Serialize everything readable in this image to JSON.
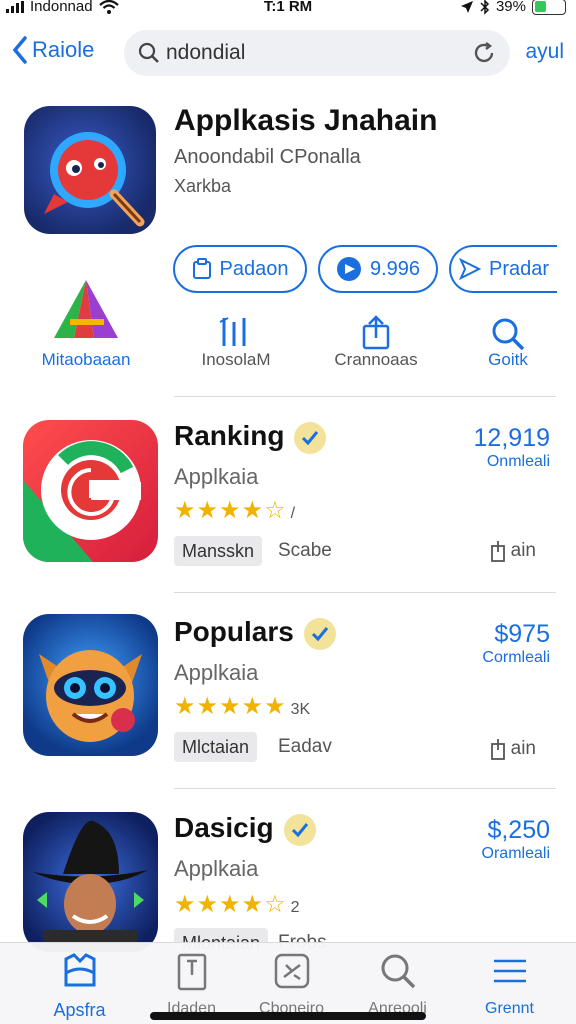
{
  "status_bar": {
    "carrier": "Indonnad",
    "time": "T:1 RM",
    "battery": "39%",
    "battery_level": 0.39
  },
  "nav": {
    "back_label": "Raiole",
    "search_value": "ndondial",
    "right_label": "ayul"
  },
  "hero": {
    "title": "Applkasis Jnahain",
    "subtitle": "Anoondabil CPonalla",
    "subtitle2": "Xarkba",
    "pills": [
      {
        "label": "Padaon",
        "icon": "clipboard-icon"
      },
      {
        "label": "9.996",
        "icon": "play-icon"
      },
      {
        "label": "Pradar",
        "icon": "send-icon"
      }
    ],
    "actions": [
      {
        "label": "Mitaobaaan",
        "icon": "logo-a-icon"
      },
      {
        "label": "InosolaM",
        "icon": "chart-icon"
      },
      {
        "label": "Crannoaas",
        "icon": "share-icon"
      },
      {
        "label": "Goitk",
        "icon": "search-icon"
      }
    ]
  },
  "apps": [
    {
      "title": "Ranking",
      "subtitle": "Applkaia",
      "rating": 4.5,
      "stars": "★★★★☆",
      "rating_count": "/",
      "tag": "Mansskn",
      "tag2": "Scabe",
      "price": "12,919",
      "price_caption": "Onmleali",
      "get_label": "ain"
    },
    {
      "title": "Populars",
      "subtitle": "Applkaia",
      "rating": 5,
      "stars": "★★★★★",
      "rating_count": "3K",
      "tag": "Mlctaian",
      "tag2": "Eadav",
      "price": "$975",
      "price_caption": "Cormleali",
      "get_label": "ain"
    },
    {
      "title": "Dasicig",
      "subtitle": "Applkaia",
      "rating": 4.5,
      "stars": "★★★★☆",
      "rating_count": "2",
      "tag": "Mlontaian",
      "tag2": "Frobs",
      "price": "$,250",
      "price_caption": "Oramleali",
      "get_label": ""
    }
  ],
  "tabbar": {
    "tabs": [
      {
        "label": "Apsfra",
        "icon": "apps-icon",
        "active": true
      },
      {
        "label": "Idaden",
        "icon": "doc-icon",
        "active": false
      },
      {
        "label": "Cboneiro",
        "icon": "games-icon",
        "active": false
      },
      {
        "label": "Anreooli",
        "icon": "search-icon",
        "active": false
      },
      {
        "label": "Grennt",
        "icon": "menu-icon",
        "active": false
      }
    ]
  },
  "colors": {
    "accent": "#1a6fe0",
    "star": "#f0b400",
    "verified": "#f3e39a"
  }
}
